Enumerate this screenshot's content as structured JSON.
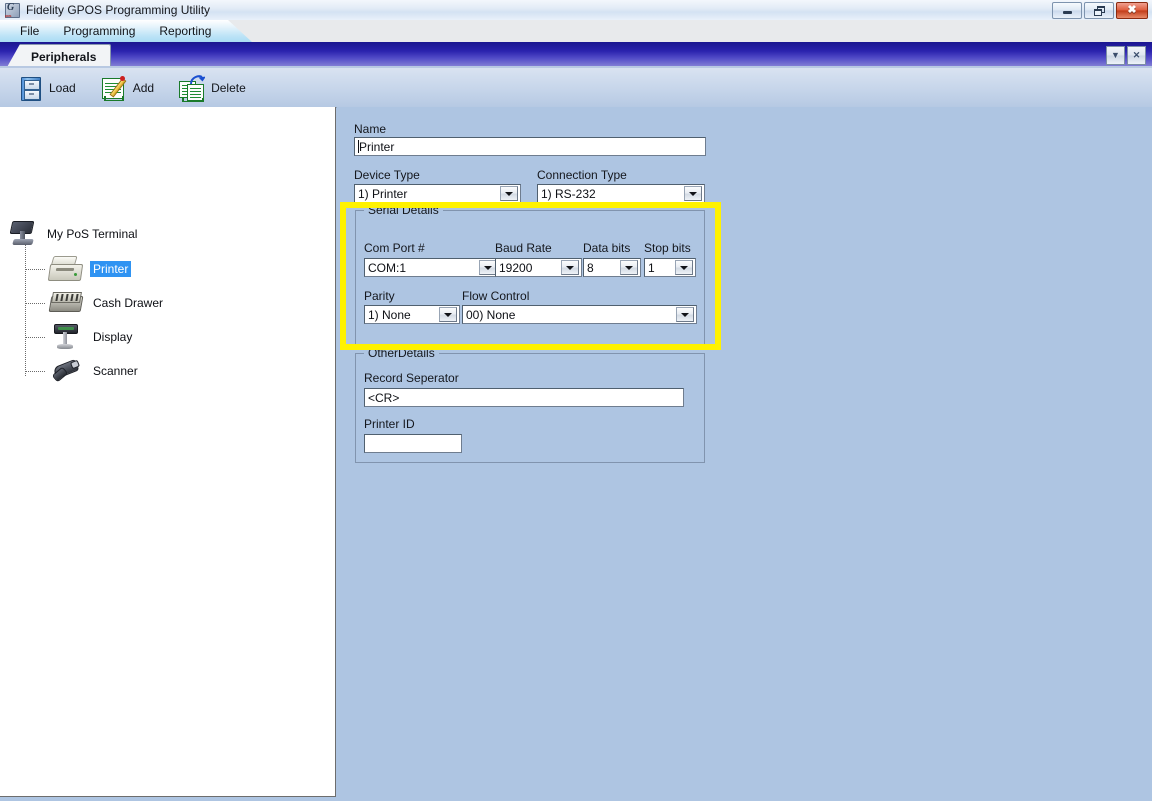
{
  "window": {
    "title": "Fidelity GPOS Programming Utility",
    "icon": "app-icon",
    "buttons": [
      {
        "name": "minimize",
        "glyph": "minimize-icon"
      },
      {
        "name": "restore",
        "glyph": "restore-icon"
      },
      {
        "name": "close",
        "glyph": "close-icon",
        "label": "✖"
      }
    ]
  },
  "menubar": {
    "items": [
      {
        "label": "File",
        "name": "menu-file"
      },
      {
        "label": "Programming",
        "name": "menu-programming"
      },
      {
        "label": "Reporting",
        "name": "menu-reporting"
      }
    ]
  },
  "mdi": {
    "tab": {
      "label": "Peripherals"
    },
    "buttons": [
      {
        "label": "▼",
        "name": "mdi-restore-button"
      },
      {
        "label": "✕",
        "name": "mdi-close-button"
      }
    ]
  },
  "toolbar": {
    "buttons": [
      {
        "label": "Load",
        "icon": "file-cabinet-icon",
        "name": "load-button"
      },
      {
        "label": "Add",
        "icon": "notepad-pencil-icon",
        "name": "add-button"
      },
      {
        "label": "Delete",
        "icon": "documents-arrow-icon",
        "name": "delete-button"
      }
    ]
  },
  "tree": {
    "root": {
      "label": "My PoS Terminal",
      "icon": "pos-terminal-icon"
    },
    "children": [
      {
        "label": "Printer",
        "icon": "printer-icon",
        "selected": true
      },
      {
        "label": "Cash Drawer",
        "icon": "cash-drawer-icon",
        "selected": false
      },
      {
        "label": "Display",
        "icon": "pole-display-icon",
        "selected": false
      },
      {
        "label": "Scanner",
        "icon": "barcode-scanner-icon",
        "selected": false
      }
    ]
  },
  "form": {
    "name": {
      "label": "Name",
      "value": "Printer"
    },
    "device_type": {
      "label": "Device Type",
      "value": "1) Printer"
    },
    "connection_type": {
      "label": "Connection Type",
      "value": "1) RS-232"
    },
    "serial_details": {
      "title": "Serial Details",
      "com_port": {
        "label": "Com Port #",
        "value": "COM:1"
      },
      "baud_rate": {
        "label": "Baud Rate",
        "value": "19200"
      },
      "data_bits": {
        "label": "Data bits",
        "value": "8"
      },
      "stop_bits": {
        "label": "Stop bits",
        "value": "1"
      },
      "parity": {
        "label": "Parity",
        "value": "1) None"
      },
      "flow_control": {
        "label": "Flow Control",
        "value": "00) None"
      }
    },
    "other_details": {
      "title": "OtherDetails",
      "record_seperator": {
        "label": "Record Seperator",
        "value": "<CR>"
      },
      "printer_id": {
        "label": "Printer ID",
        "value": ""
      }
    }
  },
  "annotation": {
    "highlight_color": "#fff200",
    "target": "serial-details-group"
  }
}
